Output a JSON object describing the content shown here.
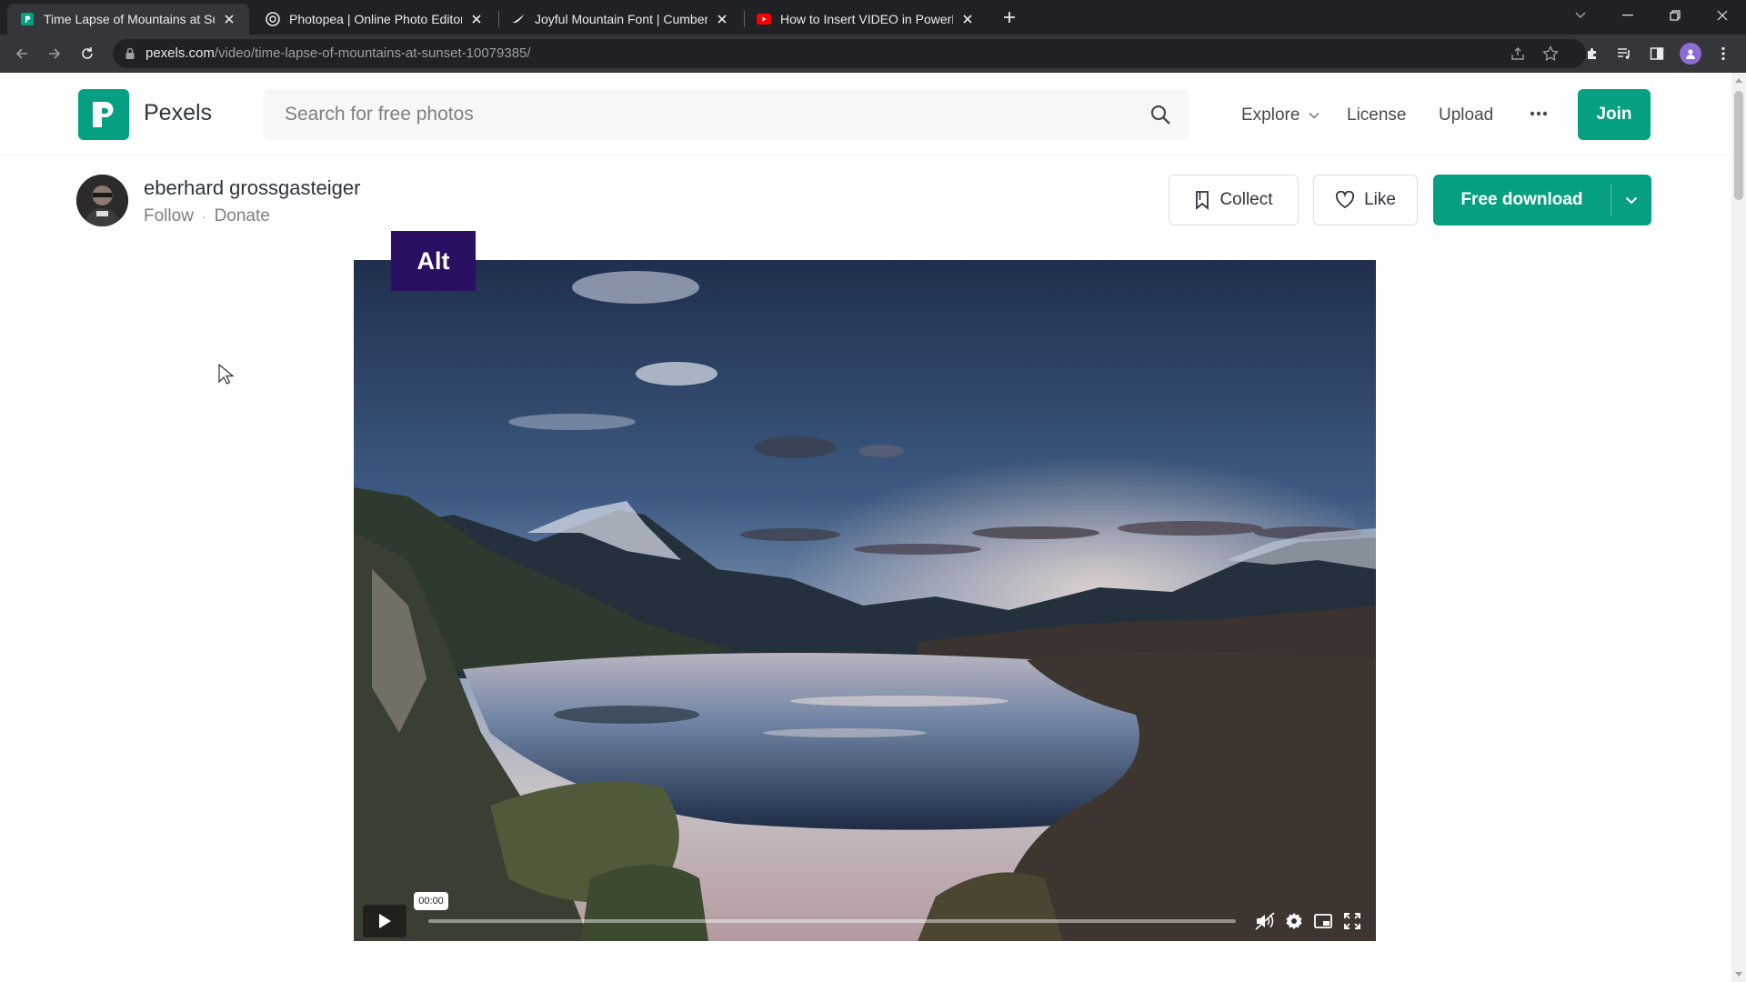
{
  "browser": {
    "tabs": [
      {
        "title": "Time Lapse of Mountains at Sun",
        "favicon": "pexels-favicon",
        "active": true
      },
      {
        "title": "Photopea | Online Photo Editor",
        "favicon": "photopea-favicon",
        "active": false
      },
      {
        "title": "Joyful Mountain Font | Cumberla",
        "favicon": "font-favicon",
        "active": false
      },
      {
        "title": "How to Insert VIDEO in PowerPo",
        "favicon": "youtube-favicon",
        "active": false
      }
    ],
    "url_host": "pexels.com",
    "url_path": "/video/time-lapse-of-mountains-at-sunset-10079385/",
    "profile_initial": ""
  },
  "header": {
    "brand": "Pexels",
    "search_placeholder": "Search for free photos",
    "nav": {
      "explore": "Explore",
      "license": "License",
      "upload": "Upload"
    },
    "join": "Join"
  },
  "author": {
    "name": "eberhard grossgasteiger",
    "follow": "Follow",
    "separator": "·",
    "donate": "Donate"
  },
  "actions": {
    "collect": "Collect",
    "like": "Like",
    "free_download": "Free download"
  },
  "video": {
    "alt_badge": "Alt",
    "time": "00:00",
    "progress": 0.0
  },
  "colors": {
    "brand_green": "#05a081",
    "alt_badge": "#2a0f63"
  }
}
